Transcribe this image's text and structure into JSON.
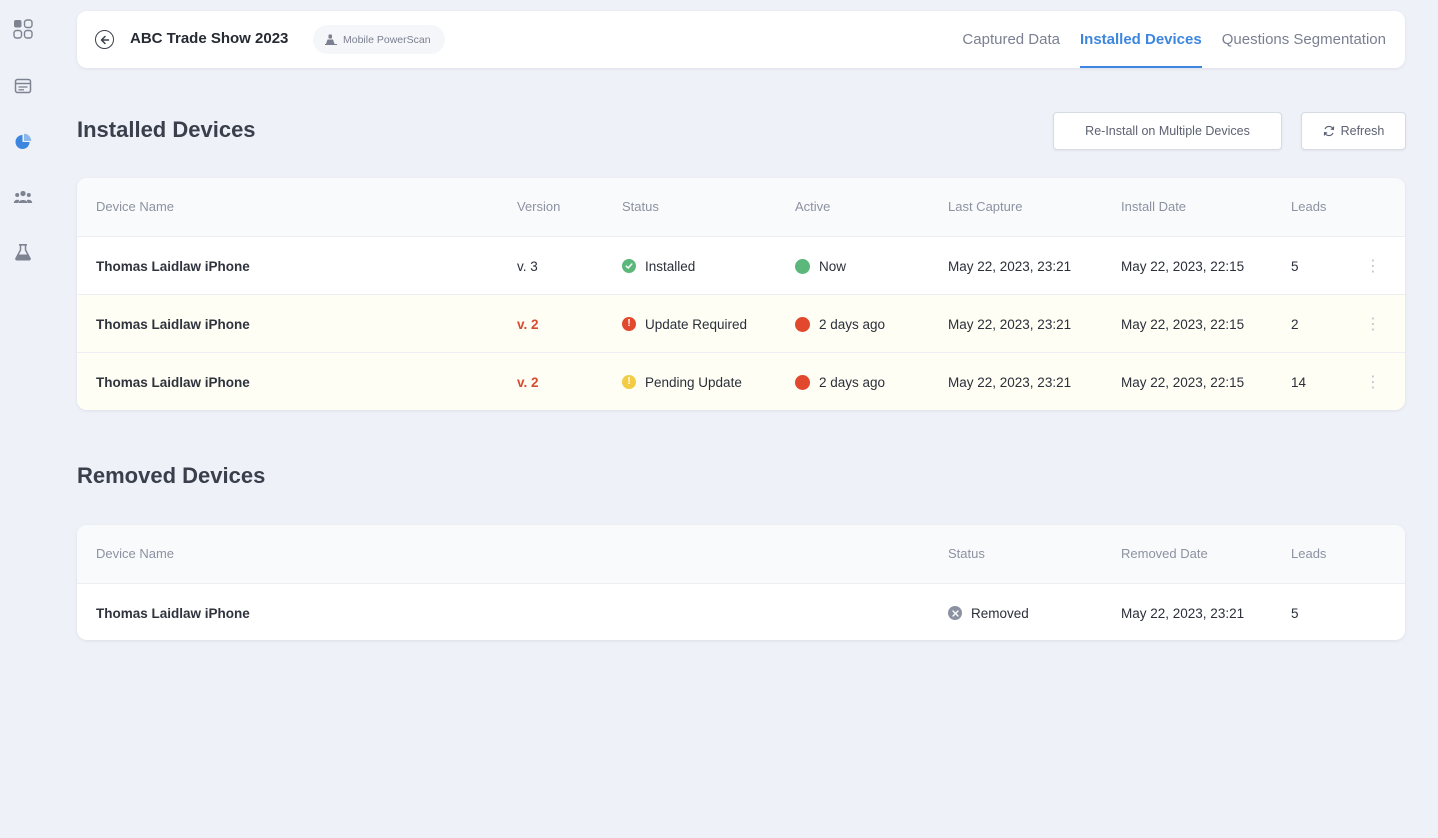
{
  "sidebar": {
    "items": [
      {
        "icon": "apps-grid-icon"
      },
      {
        "icon": "calendar-card-icon"
      },
      {
        "icon": "pie-chart-icon",
        "active": true
      },
      {
        "icon": "users-group-icon"
      },
      {
        "icon": "flask-icon"
      }
    ]
  },
  "header": {
    "title": "ABC Trade Show 2023",
    "badge": "Mobile PowerScan",
    "tabs": [
      {
        "label": "Captured Data"
      },
      {
        "label": "Installed Devices",
        "active": true
      },
      {
        "label": "Questions Segmentation"
      }
    ]
  },
  "installed": {
    "title": "Installed Devices",
    "reinstall_label": "Re-Install on Multiple Devices",
    "refresh_label": "Refresh",
    "columns": {
      "name": "Device Name",
      "version": "Version",
      "status": "Status",
      "active": "Active",
      "last_capture": "Last Capture",
      "install_date": "Install Date",
      "leads": "Leads"
    },
    "rows": [
      {
        "name": "Thomas Laidlaw iPhone",
        "version": "v. 3",
        "status": "Installed",
        "active": "Now",
        "last_capture": "May 22, 2023, 23:21",
        "install_date": "May 22, 2023, 22:15",
        "leads": "5"
      },
      {
        "name": "Thomas Laidlaw iPhone",
        "version": "v. 2",
        "status": "Update Required",
        "active": "2 days ago",
        "last_capture": "May 22, 2023, 23:21",
        "install_date": "May 22, 2023, 22:15",
        "leads": "2"
      },
      {
        "name": "Thomas Laidlaw iPhone",
        "version": "v. 2",
        "status": "Pending Update",
        "active": "2 days ago",
        "last_capture": "May 22, 2023, 23:21",
        "install_date": "May 22, 2023, 22:15",
        "leads": "14"
      }
    ]
  },
  "removed": {
    "title": "Removed Devices",
    "columns": {
      "name": "Device Name",
      "status": "Status",
      "removed_date": "Removed Date",
      "leads": "Leads"
    },
    "rows": [
      {
        "name": "Thomas Laidlaw iPhone",
        "status": "Removed",
        "removed_date": "May 22, 2023, 23:21",
        "leads": "5"
      }
    ]
  },
  "colors": {
    "accent": "#3d86e0",
    "installed": "#5cb87a",
    "error": "#e2482d",
    "pending": "#f2cc45",
    "removed": "#8c92a1",
    "active_now": "#5cb87a",
    "inactive": "#e2482d"
  }
}
